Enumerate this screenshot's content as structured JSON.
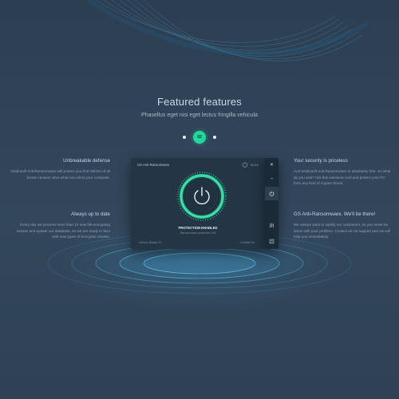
{
  "hero": {
    "title": "Featured features",
    "subtitle": "Phasellus eget nisi eget lectus fringilla vehicula"
  },
  "pager": {
    "current": "02"
  },
  "features_left": [
    {
      "title": "Unbreakable defense",
      "text": "Gridinsoft Anti-Ransomware will protect you from 99.5% of all known ransom virus what can infect your computer."
    },
    {
      "title": "Always up to date",
      "text": "Every day we process more than 10 new file-encrypting viruses and update our database, so we are ready to face with new types of encryptor viruses."
    }
  ],
  "features_right": [
    {
      "title": "Your security is priceless",
      "text": "And Gridinsoft Anti-Ransomware is absolutely free. So what do you wait? Get this awesome tool and protect your PC from any kind of cryptor threat."
    },
    {
      "title": "GS Anti-Ransomware. We'll be there!",
      "text": "We always want to satisfy our customers, so you never be alone with your problem. Contact us via support and we will help you immediately."
    }
  ],
  "app_window": {
    "title": "GS Anti-Ransomware",
    "time": "00:44",
    "status": "PROTECTION ENABLED",
    "status_sub": "Ransomware protection ON",
    "version": "Version (Beta) 0.1",
    "contact": "Contact Us"
  },
  "sidebar": {
    "close": "✕",
    "minimize": "–"
  },
  "colors": {
    "background": "#2f4257",
    "accent": "#22d79a",
    "window": "#243545"
  }
}
